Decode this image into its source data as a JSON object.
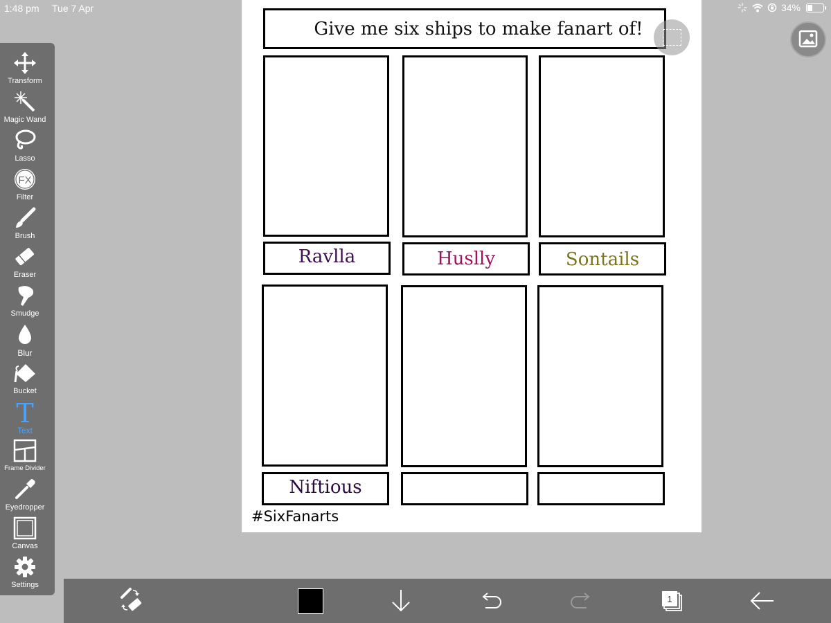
{
  "status_bar": {
    "time": "1:48 pm",
    "date": "Tue 7 Apr",
    "battery_text": "34%",
    "battery_level": 0.34
  },
  "toolbar": {
    "tools": [
      {
        "label": "Transform",
        "icon": "transform-icon"
      },
      {
        "label": "Magic Wand",
        "icon": "magic-wand-icon"
      },
      {
        "label": "Lasso",
        "icon": "lasso-icon"
      },
      {
        "label": "Filter",
        "icon": "filter-fx-icon",
        "icon_text": "FX"
      },
      {
        "label": "Brush",
        "icon": "brush-icon"
      },
      {
        "label": "Eraser",
        "icon": "eraser-icon"
      },
      {
        "label": "Smudge",
        "icon": "smudge-icon"
      },
      {
        "label": "Blur",
        "icon": "blur-drop-icon"
      },
      {
        "label": "Bucket",
        "icon": "bucket-icon"
      },
      {
        "label": "Text",
        "icon": "text-icon",
        "icon_text": "T",
        "active": true
      },
      {
        "label": "Frame Divider",
        "icon": "frame-divider-icon"
      },
      {
        "label": "Eyedropper",
        "icon": "eyedropper-icon"
      },
      {
        "label": "Canvas",
        "icon": "canvas-icon"
      },
      {
        "label": "Settings",
        "icon": "gear-icon"
      }
    ],
    "active_color": "#4aa3ff"
  },
  "canvas": {
    "title": "Give me six ships to make fanart of!",
    "hashtag": "#SixFanarts",
    "labels": [
      {
        "text": "Ravlla",
        "color": "#3d0f4d"
      },
      {
        "text": "Huslly",
        "color": "#a0105e"
      },
      {
        "text": "Sontails",
        "color": "#7a7420"
      },
      {
        "text": "Niftious",
        "color": "#2b0a45"
      },
      {
        "text": "",
        "color": "#000000"
      },
      {
        "text": "",
        "color": "#000000"
      }
    ]
  },
  "bottom_bar": {
    "current_color": "#000000",
    "layer_count": "1",
    "buttons": [
      "layer-transform-icon",
      "color-swatch",
      "download-arrow-icon",
      "undo-icon",
      "redo-icon",
      "layers-icon",
      "back-arrow-icon"
    ]
  }
}
